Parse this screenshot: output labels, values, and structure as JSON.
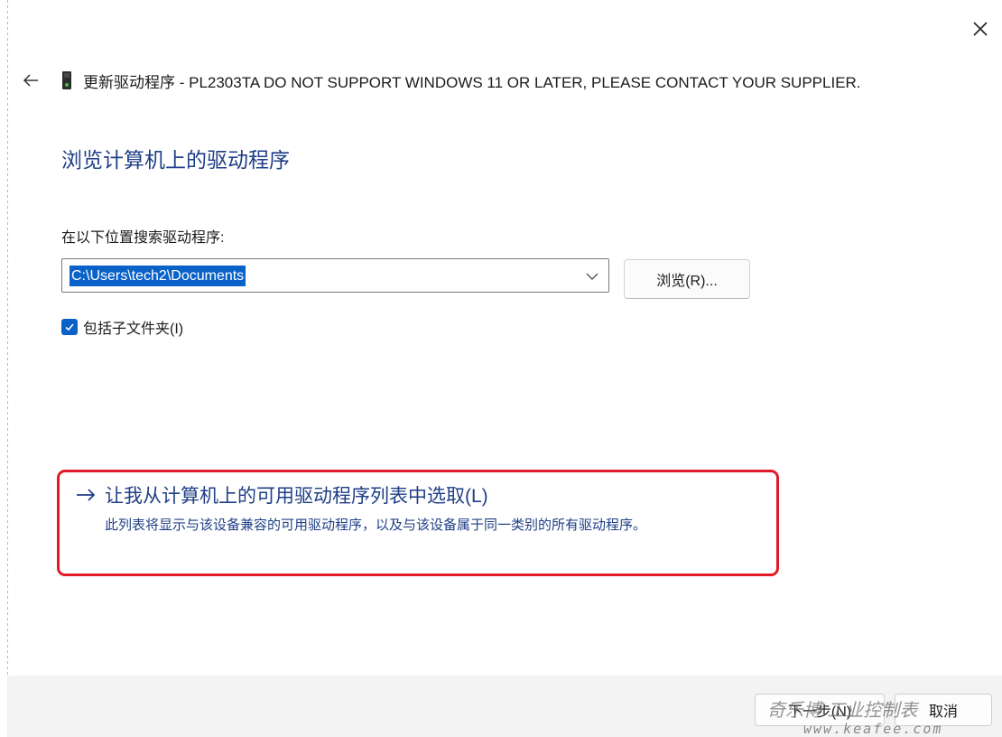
{
  "window": {
    "title": "更新驱动程序 - PL2303TA DO NOT SUPPORT WINDOWS 11 OR LATER, PLEASE CONTACT YOUR SUPPLIER.",
    "close_icon": "close-icon",
    "back_icon": "back-arrow-icon",
    "device_icon": "usb-device-icon"
  },
  "main": {
    "heading": "浏览计算机上的驱动程序",
    "search_label": "在以下位置搜索驱动程序:",
    "path_value": "C:\\Users\\tech2\\Documents",
    "browse_label": "浏览(R)...",
    "include_subfolders": {
      "label": "包括子文件夹(I)",
      "checked": true
    },
    "pick_from_list": {
      "label": "让我从计算机上的可用驱动程序列表中选取(L)",
      "description": "此列表将显示与该设备兼容的可用驱动程序，以及与该设备属于同一类别的所有驱动程序。"
    }
  },
  "footer": {
    "next_label": "下一步(N)",
    "cancel_label": "取消"
  },
  "watermark": {
    "text": "奇乐博 工业控制表",
    "url": "www.keafee.com"
  },
  "colors": {
    "accent": "#0a62c9",
    "link": "#1f3f86",
    "highlight_border": "#e11a27",
    "footer_bg": "#f3f3f3"
  }
}
